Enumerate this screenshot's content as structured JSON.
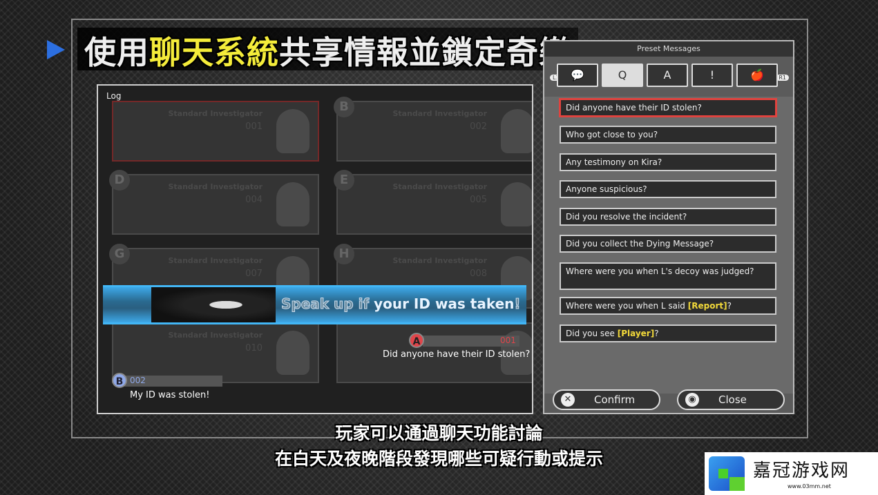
{
  "title": {
    "part1": "使用",
    "highlight": "聊天系統",
    "part2": "共享情報並鎖定奇樂"
  },
  "log": {
    "label": "Log",
    "cards": [
      {
        "letter": "",
        "role": "Standard Investigator",
        "num": "001"
      },
      {
        "letter": "B",
        "role": "Standard Investigator",
        "num": "002"
      },
      {
        "letter": "D",
        "role": "Standard Investigator",
        "num": "004"
      },
      {
        "letter": "E",
        "role": "Standard Investigator",
        "num": "005"
      },
      {
        "letter": "G",
        "role": "Standard Investigator",
        "num": "007"
      },
      {
        "letter": "H",
        "role": "Standard Investigator",
        "num": "008"
      },
      {
        "letter": "",
        "role": "Standard Investigator",
        "num": "010"
      },
      {
        "letter": "",
        "role": "",
        "num": ""
      }
    ],
    "banner": {
      "dim": "Speak up if ",
      "bright": "your ID was taken",
      "end": "!"
    },
    "messages": [
      {
        "player": "A",
        "id": "001",
        "text": "Did anyone have their ID stolen?",
        "color": "#e0454a"
      },
      {
        "player": "B",
        "id": "002",
        "text": "My ID was stolen!",
        "color": "#8fa8e8"
      }
    ]
  },
  "preset": {
    "header": "Preset Messages",
    "l1": "L1",
    "r1": "R1",
    "tabs": [
      {
        "icon": "chat-icon",
        "glyph": "💬"
      },
      {
        "icon": "question-icon",
        "glyph": "Q"
      },
      {
        "icon": "answer-icon",
        "glyph": "A"
      },
      {
        "icon": "alert-icon",
        "glyph": "!"
      },
      {
        "icon": "apple-notebook-icon",
        "glyph": "🍎"
      }
    ],
    "items": [
      {
        "text": "Did anyone have their ID stolen?"
      },
      {
        "text": "Who got close to you?"
      },
      {
        "text": "Any testimony on Kira?"
      },
      {
        "text": "Anyone suspicious?"
      },
      {
        "text": "Did you resolve the incident?"
      },
      {
        "text": "Did you collect the Dying Message?"
      },
      {
        "text": "Where were you when L's decoy was judged?"
      },
      {
        "text": "Where were you when L said ",
        "key": "[Report]",
        "tail": "?"
      },
      {
        "text": "Did you see ",
        "key": "[Player]",
        "tail": "?"
      }
    ],
    "confirm": "Confirm",
    "close": "Close"
  },
  "subtitles": [
    "玩家可以通過聊天功能討論",
    "在白天及夜晚階段發現哪些可疑行動或提示"
  ],
  "watermark": {
    "name": "嘉冠游戏网",
    "url": "www.03mm.net"
  },
  "colors": {
    "accent_blue": "#3da8e8",
    "highlight_yellow": "#f4ec3a",
    "selected_red": "#e0433f"
  }
}
